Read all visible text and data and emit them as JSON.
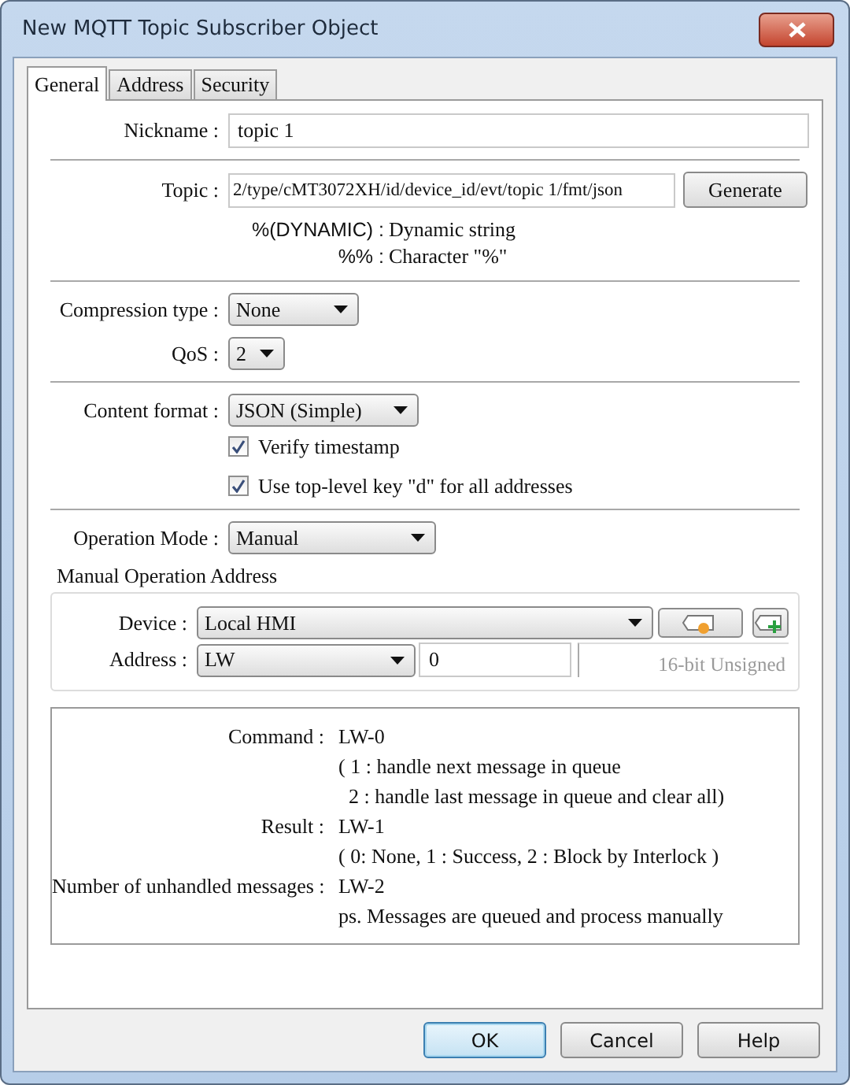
{
  "window": {
    "title": "New MQTT Topic Subscriber Object"
  },
  "tabs": [
    {
      "label": "General",
      "selected": true
    },
    {
      "label": "Address",
      "selected": false
    },
    {
      "label": "Security",
      "selected": false
    }
  ],
  "nickname": {
    "label": "Nickname :",
    "value": "topic 1"
  },
  "topic": {
    "label": "Topic :",
    "value": "2/type/cMT3072XH/id/device_id/evt/topic 1/fmt/json",
    "button": "Generate"
  },
  "topic_help": [
    {
      "key": "%(DYNAMIC) :",
      "text": "Dynamic string"
    },
    {
      "key": "%% :",
      "text": "Character \"%\""
    }
  ],
  "compression": {
    "label": "Compression type :",
    "value": "None"
  },
  "qos": {
    "label": "QoS :",
    "value": "2"
  },
  "content_format": {
    "label": "Content format :",
    "value": "JSON (Simple)"
  },
  "options": [
    {
      "label": "Verify timestamp",
      "checked": true
    },
    {
      "label": "Use top-level key \"d\" for all addresses",
      "checked": true
    }
  ],
  "operation_mode": {
    "label": "Operation Mode :",
    "value": "Manual"
  },
  "manual_address": {
    "title": "Manual Operation Address",
    "device_label": "Device :",
    "device": "Local HMI",
    "address_label": "Address :",
    "address_type": "LW",
    "address_value": "0",
    "data_format": "16-bit Unsigned"
  },
  "info": [
    {
      "label": "Command :",
      "lines": [
        "LW-0",
        "( 1 : handle next message in queue",
        "  2 : handle last message in queue and clear all)"
      ]
    },
    {
      "label": "Result :",
      "lines": [
        "LW-1",
        "( 0: None, 1 : Success, 2 : Block by Interlock )"
      ]
    },
    {
      "label": "Number of unhandled messages :",
      "lines": [
        "LW-2",
        "ps. Messages are queued and process manually"
      ]
    }
  ],
  "buttons": [
    {
      "label": "OK",
      "default": true
    },
    {
      "label": "Cancel",
      "default": false
    },
    {
      "label": "Help",
      "default": false
    }
  ]
}
